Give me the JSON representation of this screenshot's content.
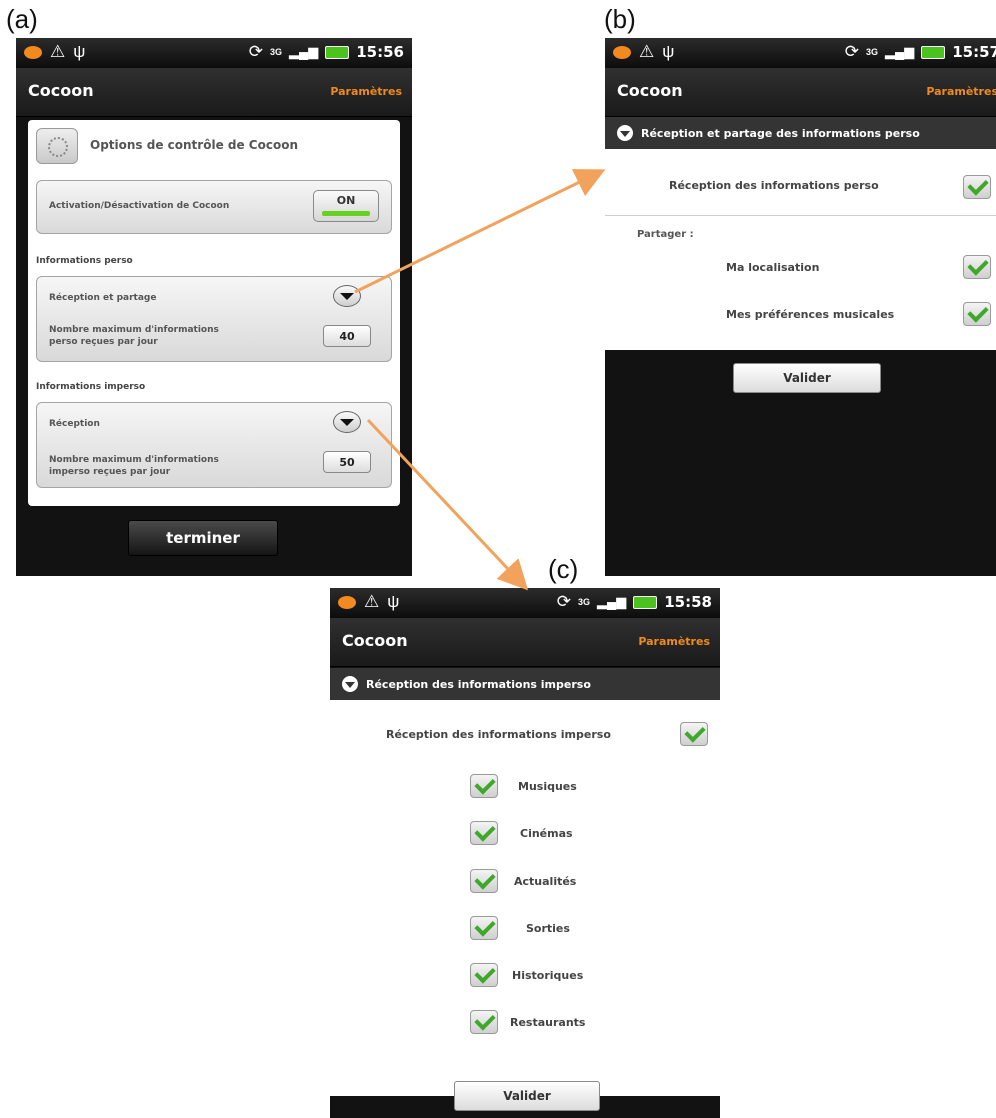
{
  "labels": {
    "a": "(a)",
    "b": "(b)",
    "c": "(c)"
  },
  "status": {
    "time_a": "15:56",
    "time_b": "15:57",
    "time_c": "15:58",
    "network": "3G"
  },
  "app": {
    "title": "Cocoon",
    "settings": "Paramètres"
  },
  "screen_a": {
    "header": "Options de contrôle de Cocoon",
    "activation_label": "Activation/Désactivation de Cocoon",
    "activation_value": "ON",
    "perso_title": "Informations perso",
    "perso_reception": "Réception et partage",
    "perso_max_line1": "Nombre maximum d'informations",
    "perso_max_line2": "perso reçues par jour",
    "perso_max_value": "40",
    "imperso_title": "Informations imperso",
    "imperso_reception": "Réception",
    "imperso_max_line1": "Nombre maximum d'informations",
    "imperso_max_line2": "imperso reçues par jour",
    "imperso_max_value": "50",
    "finish_button": "terminer"
  },
  "screen_b": {
    "section": "Réception et partage des informations perso",
    "reception": "Réception des informations perso",
    "share_label": "Partager :",
    "options": [
      "Ma localisation",
      "Mes préférences musicales"
    ],
    "validate_button": "Valider"
  },
  "screen_c": {
    "section": "Réception des informations imperso",
    "reception": "Réception des informations imperso",
    "categories": [
      "Musiques",
      "Cinémas",
      "Actualités",
      "Sorties",
      "Historiques",
      "Restaurants"
    ],
    "validate_button": "Valider"
  },
  "colors": {
    "accent": "#f08a1c",
    "arrow": "#f2a25a",
    "check": "#3fa82a",
    "toggle_on": "#66d11e"
  }
}
